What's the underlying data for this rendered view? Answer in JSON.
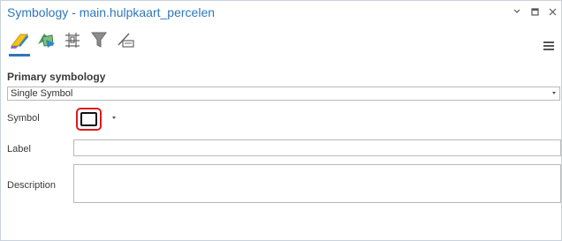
{
  "pane": {
    "title": "Symbology - main.hulpkaart_percelen",
    "active_tab": "primary-symbology"
  },
  "toolbar": {
    "tabs": [
      {
        "id": "primary-symbology",
        "icon": "primary-symbology-icon"
      },
      {
        "id": "vary-symbology",
        "icon": "vary-symbology-icon"
      },
      {
        "id": "symbol-layer-drawing",
        "icon": "symbol-layer-drawing-icon"
      },
      {
        "id": "symbol-classes",
        "icon": "filter-icon"
      },
      {
        "id": "masking",
        "icon": "masking-icon"
      }
    ]
  },
  "section": {
    "title": "Primary symbology"
  },
  "renderer": {
    "selected": "Single Symbol"
  },
  "form": {
    "symbol_label": "Symbol",
    "label_label": "Label",
    "label_value": "",
    "description_label": "Description",
    "description_value": ""
  },
  "colors": {
    "accent": "#2e77b9",
    "highlight_red": "#e0191c"
  }
}
